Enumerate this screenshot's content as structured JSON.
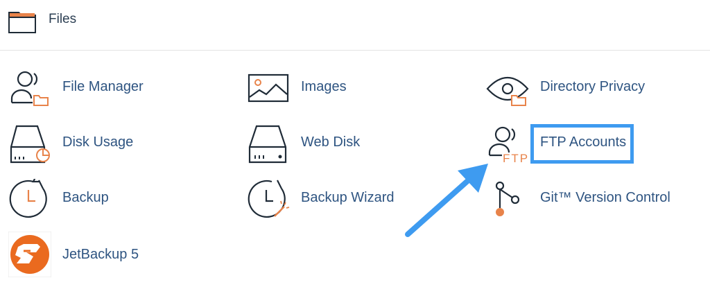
{
  "section": {
    "title": "Files",
    "icon": "folder-icon",
    "accent": "#e8834a"
  },
  "items": [
    {
      "label": "File Manager",
      "icon": "user-folder-icon"
    },
    {
      "label": "Images",
      "icon": "image-icon"
    },
    {
      "label": "Directory Privacy",
      "icon": "eye-folder-icon"
    },
    {
      "label": "Disk Usage",
      "icon": "disk-usage-icon"
    },
    {
      "label": "Web Disk",
      "icon": "drive-icon"
    },
    {
      "label": "FTP Accounts",
      "icon": "ftp-user-icon",
      "ftp_text": "FTP"
    },
    {
      "label": "Backup",
      "icon": "clock-backup-icon"
    },
    {
      "label": "Backup Wizard",
      "icon": "clock-wand-icon"
    },
    {
      "label": "Git™ Version Control",
      "icon": "git-branch-icon"
    },
    {
      "label": "JetBackup 5",
      "icon": "jetbackup-logo-icon"
    }
  ],
  "annotation": {
    "arrow_color": "#3e9bf0",
    "highlight_color": "#3e9bf0"
  }
}
